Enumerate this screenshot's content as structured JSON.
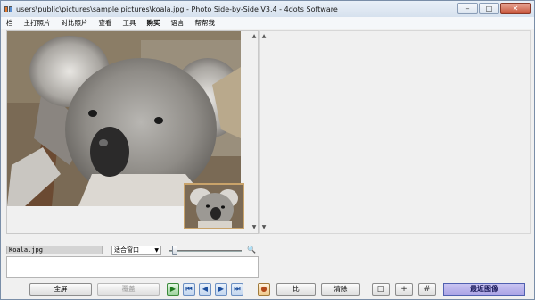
{
  "window": {
    "title": "users\\public\\pictures\\sample pictures\\koala.jpg - Photo Side-by-Side V3.4 - 4dots Software",
    "minimize_glyph": "–",
    "maximize_glyph": "□",
    "close_glyph": "✕"
  },
  "menu": [
    "档",
    "主打照片",
    "对比照片",
    "查看",
    "工具",
    "购买",
    "语言",
    "帮帮我"
  ],
  "menu_bold_index": 5,
  "left_pane": {
    "file_name": "Koala.jpg",
    "zoom_mode": "适合窗口",
    "zoom_slider_level": 0.05,
    "comment": ""
  },
  "buttons": {
    "fullscreen": "全屏",
    "overlay": "覆盖",
    "compare": "比",
    "clear": "清除",
    "recent_images": "最近图像"
  },
  "nav_glyphs": {
    "play": "▶",
    "first": "⏮",
    "prev": "◀",
    "next": "▶",
    "last": "⏭"
  },
  "layout_glyphs": {
    "single": "□",
    "split4": "+",
    "grid": "#"
  },
  "icons": {
    "app": "side-by-side-icon",
    "zoom": "magnifier-icon",
    "settings": "color-wheel-icon"
  },
  "colors": {
    "recent_button_bg": "#aba4e6",
    "thumb_border": "#c9a36a",
    "nav_blue": "#1d4f9e",
    "play_green": "#1f7a1f"
  }
}
